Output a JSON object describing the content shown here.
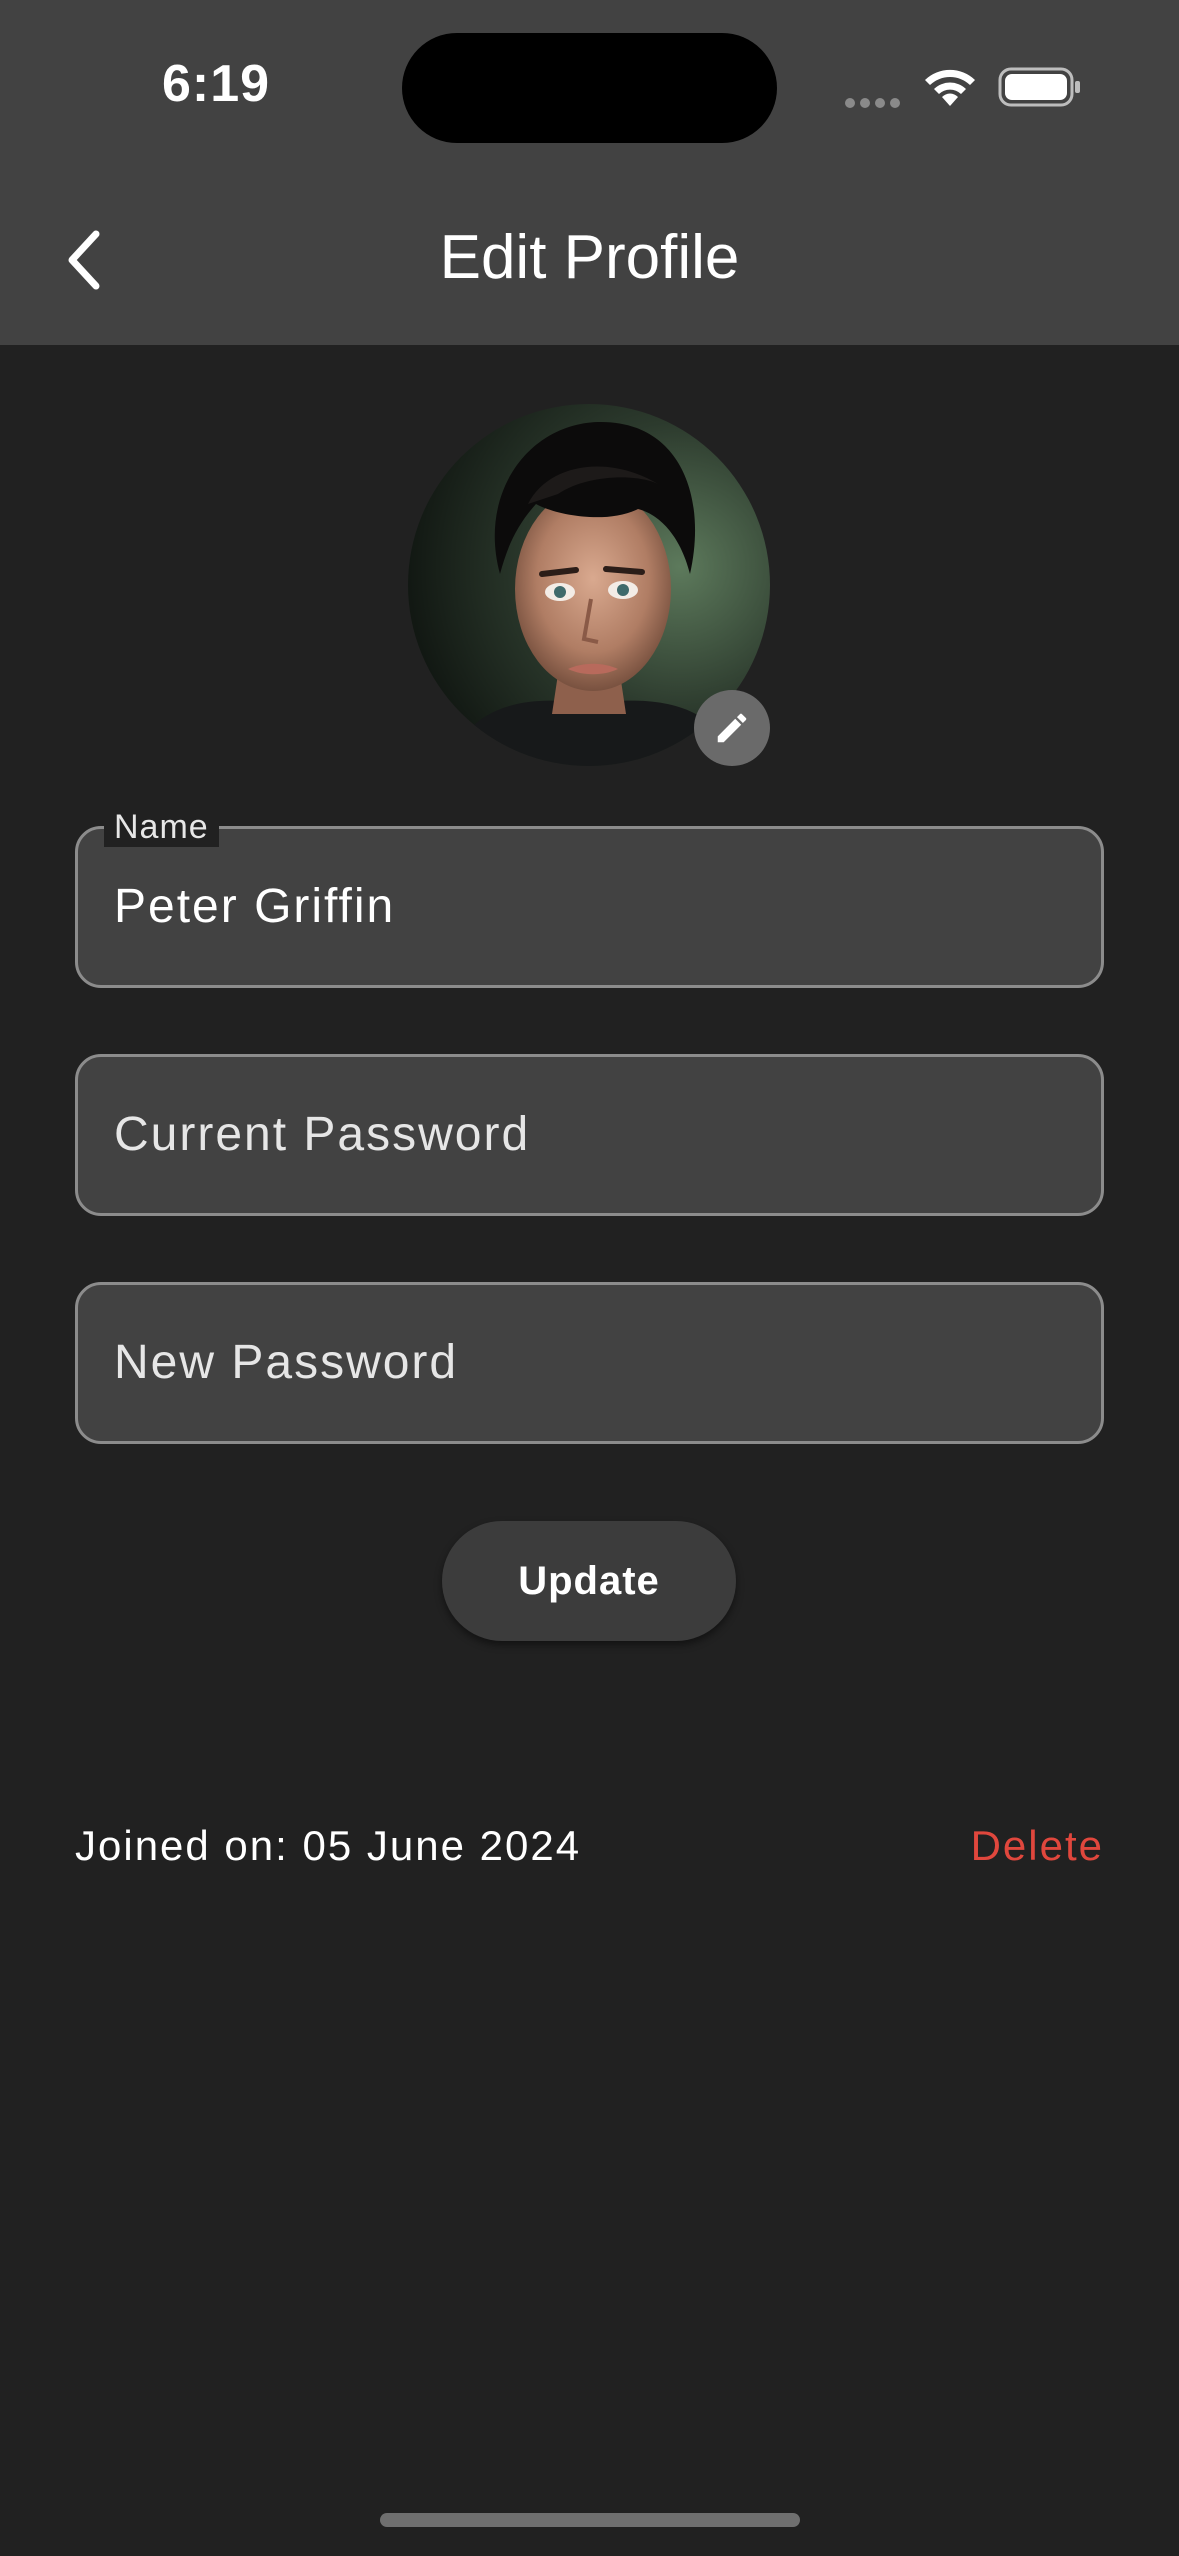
{
  "status_bar": {
    "time": "6:19"
  },
  "header": {
    "title": "Edit Profile",
    "back_icon": "chevron-left-icon"
  },
  "profile": {
    "edit_icon": "pencil-icon"
  },
  "form": {
    "name": {
      "label": "Name",
      "value": "Peter Griffin"
    },
    "current_password": {
      "placeholder": "Current Password"
    },
    "new_password": {
      "placeholder": "New Password"
    },
    "update_label": "Update"
  },
  "footer": {
    "joined_text": "Joined on: 05 June 2024",
    "delete_label": "Delete"
  },
  "colors": {
    "background": "#212121",
    "header": "#424242",
    "field_fill": "#424242",
    "field_border": "#8c8c8c",
    "delete": "#e0473d"
  }
}
